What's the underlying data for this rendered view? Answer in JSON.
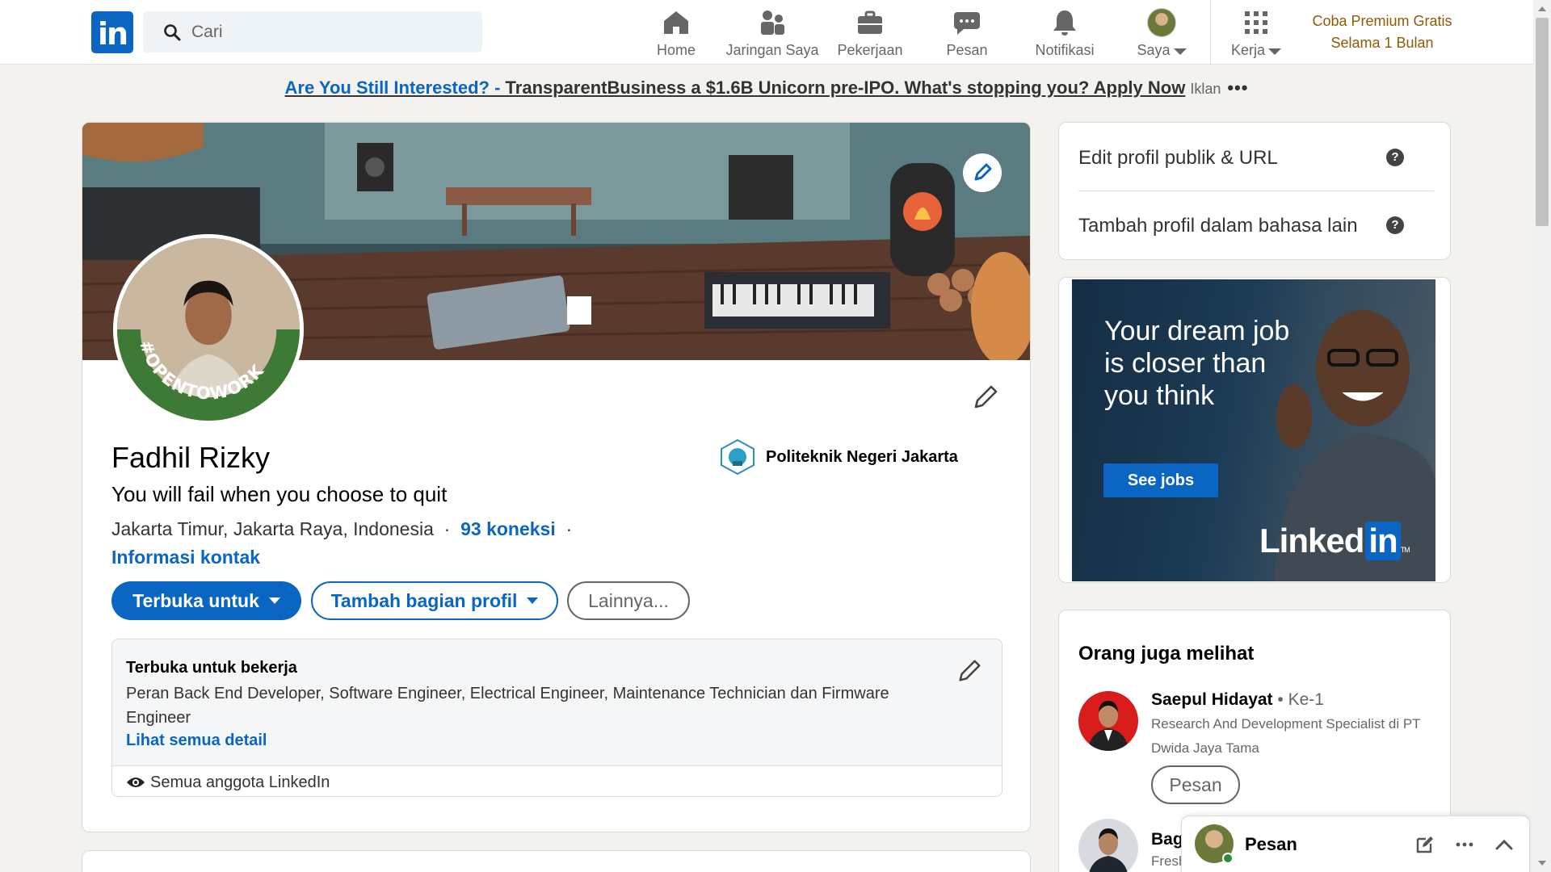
{
  "nav": {
    "logo": "in",
    "search_placeholder": "Cari",
    "items": [
      {
        "label": "Home",
        "icon": "home-icon"
      },
      {
        "label": "Jaringan Saya",
        "icon": "network-icon"
      },
      {
        "label": "Pekerjaan",
        "icon": "briefcase-icon"
      },
      {
        "label": "Pesan",
        "icon": "chat-icon"
      },
      {
        "label": "Notifikasi",
        "icon": "bell-icon"
      },
      {
        "label": "Saya",
        "icon": "avatar"
      },
      {
        "label": "Kerja",
        "icon": "grid-icon"
      }
    ],
    "premium_line1": "Coba Premium Gratis",
    "premium_line2": "Selama 1 Bulan"
  },
  "promo": {
    "highlight": "Are You Still Interested? -",
    "text": " TransparentBusiness a $1.6B Unicorn pre-IPO. What's stopping you? Apply Now",
    "ad_label": "Iklan",
    "more": "•••"
  },
  "profile": {
    "name": "Fadhil Rizky",
    "headline": "You will fail when you choose to quit",
    "location": "Jakarta Timur, Jakarta Raya, Indonesia",
    "separator": "·",
    "connections": "93 koneksi",
    "contact_info": "Informasi kontak",
    "school": "Politeknik Negeri Jakarta",
    "photo_badge": "#OPENTOWORK",
    "buttons": {
      "open_to": "Terbuka untuk",
      "add_section": "Tambah bagian profil",
      "more": "Lainnya..."
    },
    "open_to_work": {
      "title": "Terbuka untuk bekerja",
      "description": "Peran Back End Developer, Software Engineer, Electrical Engineer, Maintenance Technician dan Firmware Engineer",
      "link": "Lihat semua detail",
      "visibility": "Semua anggota LinkedIn"
    }
  },
  "sidebar": {
    "edit_public": "Edit profil publik & URL",
    "add_language": "Tambah profil dalam bahasa lain",
    "help_glyph": "?",
    "ad": {
      "text": "Your dream job is closer than you think",
      "button": "See jobs",
      "brand": "Linked",
      "brand_in": "in",
      "brand_tm": "TM"
    },
    "people_title": "Orang juga melihat",
    "people": [
      {
        "name": "Saepul Hidayat",
        "degree": " • Ke-1",
        "role": "Research And Development Specialist di PT Dwida Jaya Tama",
        "action": "Pesan"
      },
      {
        "name": "Bag",
        "degree": "",
        "role": "Fresh"
      }
    ]
  },
  "messaging": {
    "label": "Pesan"
  },
  "colors": {
    "brand": "#0a66c2",
    "premium": "#915907",
    "background": "#f3f2ef"
  }
}
